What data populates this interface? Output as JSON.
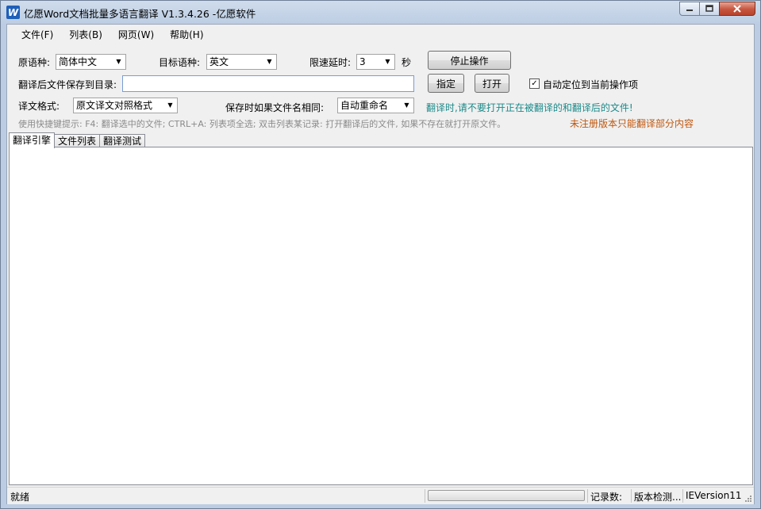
{
  "window": {
    "title": "亿愿Word文档批量多语言翻译 V1.3.4.26 -亿愿软件",
    "app_icon_letter": "W"
  },
  "menu": [
    "文件(F)",
    "列表(B)",
    "网页(W)",
    "帮助(H)"
  ],
  "form": {
    "source_lang_label": "原语种:",
    "source_lang_value": "简体中文",
    "target_lang_label": "目标语种:",
    "target_lang_value": "英文",
    "delay_label": "限速延时:",
    "delay_value": "3",
    "delay_unit": "秒",
    "stop_button": "停止操作",
    "save_dir_label": "翻译后文件保存到目录:",
    "save_dir_value": "",
    "specify_button": "指定",
    "open_button": "打开",
    "auto_locate_label": "自动定位到当前操作项",
    "auto_locate_checked": "✓",
    "format_label": "译文格式:",
    "format_value": "原文译文对照格式",
    "same_name_label": "保存时如果文件名相同:",
    "same_name_value": "自动重命名",
    "warning_text": "翻译时,请不要打开正在被翻译的和翻译后的文件!",
    "hint_text": "使用快捷键提示: F4: 翻译选中的文件; CTRL+A: 列表项全选; 双击列表某记录: 打开翻译后的文件, 如果不存在就打开原文件。",
    "unregistered_text": "未注册版本只能翻译部分内容"
  },
  "tabs": [
    "翻译引擎",
    "文件列表",
    "翻译测试"
  ],
  "status": {
    "state": "就绪",
    "progress": 0,
    "record_count_label": "记录数:",
    "version_check": "版本检测...",
    "ie_version": "IEVersion11"
  },
  "colors": {
    "teal": "#1c8a8a",
    "orange": "#c0570e"
  }
}
